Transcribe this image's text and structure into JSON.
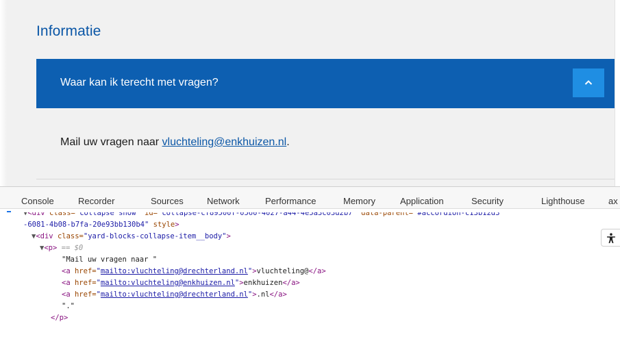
{
  "page": {
    "section_title": "Informatie",
    "accordion": {
      "title": "Waar kan ik terecht met vragen?",
      "body_prefix": "Mail uw vragen naar ",
      "email_link": "vluchteling@enkhuizen.nl",
      "body_suffix": "."
    },
    "colors": {
      "header_bg": "#0d5fb1",
      "toggle_bg": "#1f8ee3",
      "title_color": "#0a56a6"
    }
  },
  "devtools": {
    "tabs": [
      "Console",
      "Recorder",
      "Sources",
      "Network",
      "Performance",
      "Memory",
      "Application",
      "Security",
      "Lighthouse",
      "ax"
    ],
    "elements": {
      "line0": {
        "tag_open": "<div",
        "a1": " class=",
        "v1": "\"collapse show\"",
        "a2": " id=",
        "v2": "\"collapse-cf89500f-0560-4027-a44-4e5a3c03d2b7\"",
        "a3": " data-parent=",
        "v3": "\"#accordion-c13b12d3"
      },
      "line1": {
        "v": "-6081-4b08-b7fa-20e93bb130b4\"",
        "a": " style",
        "t": ">"
      },
      "line2": {
        "tag": "<div",
        "a": " class=",
        "v": "\"yard-blocks-collapse-item__body\"",
        "t": ">"
      },
      "line3": {
        "tag": "<p>",
        "eq": " == ",
        "ref": "$0"
      },
      "line4": {
        "text": "\"Mail uw vragen naar \""
      },
      "line5": {
        "tag": "<a",
        "a": " href=",
        "href": "mailto:vluchteling@drechterland.nl",
        "text": "vluchteling@",
        "close": "</a>"
      },
      "line6": {
        "tag": "<a",
        "a": " href=",
        "href": "mailto:vluchteling@enkhuizen.nl",
        "text": "enkhuizen",
        "close": "</a>"
      },
      "line7": {
        "tag": "<a",
        "a": " href=",
        "href": "mailto:vluchteling@drechterland.nl",
        "text": ".nl",
        "close": "</a>"
      },
      "line8": {
        "text": "\".\""
      },
      "line9": {
        "tag": "</p>"
      }
    },
    "icons": {
      "accessibility": "accessibility-icon",
      "toggle": "chevron-up-icon"
    }
  }
}
